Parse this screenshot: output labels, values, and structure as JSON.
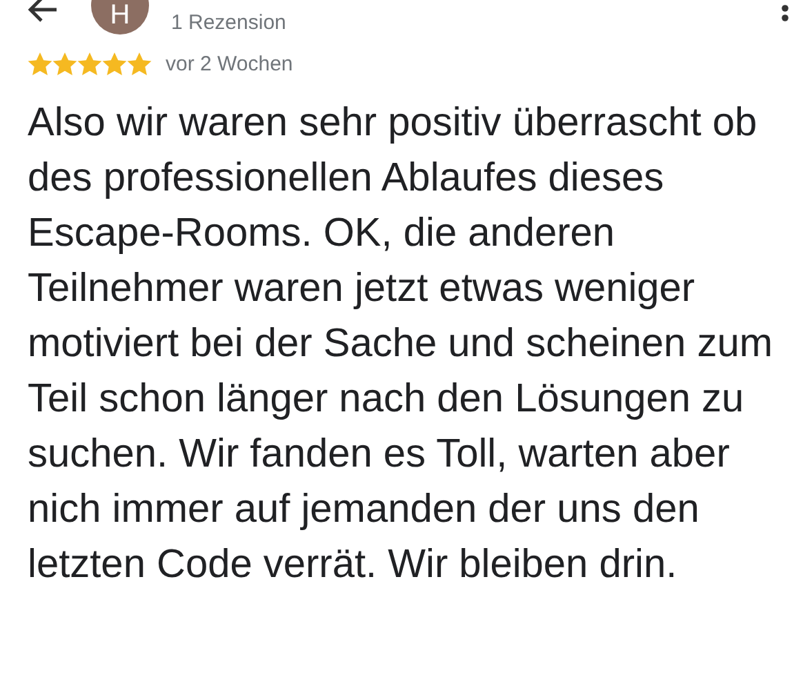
{
  "header": {
    "avatar_letter": "H",
    "review_count": "1 Rezension"
  },
  "review": {
    "stars": 5,
    "date": "vor 2 Wochen",
    "text": "Also wir waren sehr positiv überrascht ob des professionellen Ablaufes dieses Escape-Rooms. OK, die anderen Teilnehmer waren jetzt etwas weniger motiviert bei der Sache und scheinen zum Teil schon länger nach den Lösungen zu suchen. Wir fanden es Toll, warten aber nich immer auf jemanden der uns den letzten Code verrät. Wir bleiben drin."
  }
}
